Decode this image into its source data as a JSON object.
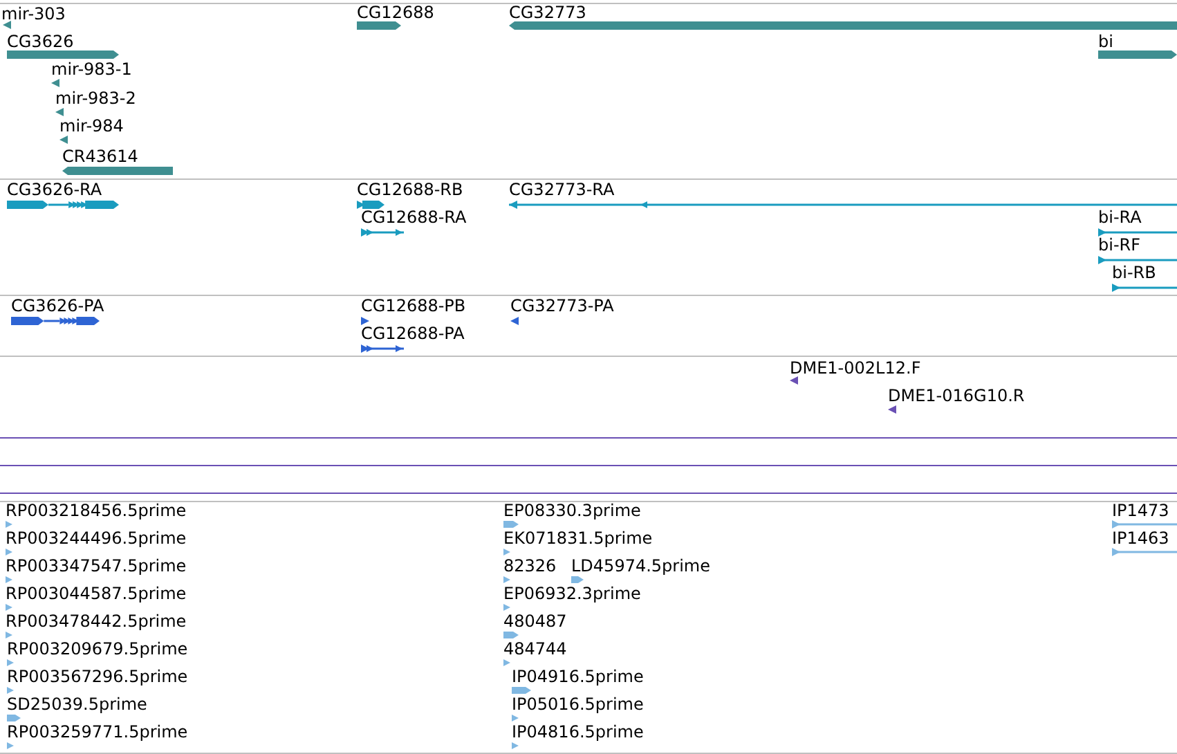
{
  "tracks": [
    {
      "kind": "gene",
      "color": "#3f8f91",
      "features": [
        {
          "label": "mir-303",
          "kind": "tick",
          "reverse": true
        },
        {
          "label": "CG3626",
          "kind": "block",
          "reverse": false
        },
        {
          "label": "mir-983-1",
          "kind": "tick",
          "reverse": true
        },
        {
          "label": "mir-983-2",
          "kind": "tick",
          "reverse": true
        },
        {
          "label": "mir-984",
          "kind": "tick",
          "reverse": true
        },
        {
          "label": "CR43614",
          "kind": "block",
          "reverse": true
        },
        {
          "label": "CG12688",
          "kind": "block",
          "reverse": false
        },
        {
          "label": "CG32773",
          "kind": "block",
          "reverse": true
        },
        {
          "label": "bi",
          "kind": "block",
          "reverse": false
        }
      ]
    },
    {
      "kind": "transcript",
      "color": "#1a9cbf",
      "features": [
        {
          "label": "CG3626-RA",
          "kind": "spliced",
          "reverse": false
        },
        {
          "label": "CG12688-RB",
          "kind": "spliced",
          "reverse": false
        },
        {
          "label": "CG12688-RA",
          "kind": "line",
          "reverse": false
        },
        {
          "label": "CG32773-RA",
          "kind": "line",
          "reverse": true
        },
        {
          "label": "bi-RA",
          "kind": "line",
          "reverse": false
        },
        {
          "label": "bi-RF",
          "kind": "line",
          "reverse": false
        },
        {
          "label": "bi-RB",
          "kind": "line",
          "reverse": false
        }
      ]
    },
    {
      "kind": "protein",
      "color": "#2e64d4",
      "features": [
        {
          "label": "CG3626-PA",
          "kind": "spliced",
          "reverse": false
        },
        {
          "label": "CG12688-PB",
          "kind": "tick",
          "reverse": false
        },
        {
          "label": "CG12688-PA",
          "kind": "line",
          "reverse": false
        },
        {
          "label": "CG32773-PA",
          "kind": "tick",
          "reverse": true
        }
      ]
    },
    {
      "kind": "clone",
      "color": "#6a50b4",
      "features": [
        {
          "label": "DME1-002L12.F",
          "kind": "tick",
          "reverse": true
        },
        {
          "label": "DME1-016G10.R",
          "kind": "tick",
          "reverse": true
        }
      ]
    },
    {
      "kind": "est",
      "color": "#80b8e2",
      "features": [
        {
          "label": "RP003218456.5prime",
          "kind": "tick",
          "reverse": false
        },
        {
          "label": "RP003244496.5prime",
          "kind": "tick",
          "reverse": false
        },
        {
          "label": "RP003347547.5prime",
          "kind": "tick",
          "reverse": false
        },
        {
          "label": "RP003044587.5prime",
          "kind": "tick",
          "reverse": false
        },
        {
          "label": "RP003478442.5prime",
          "kind": "tick",
          "reverse": false
        },
        {
          "label": "RP003209679.5prime",
          "kind": "tick",
          "reverse": false
        },
        {
          "label": "RP003567296.5prime",
          "kind": "tick",
          "reverse": false
        },
        {
          "label": "SD25039.5prime",
          "kind": "block",
          "reverse": false
        },
        {
          "label": "RP003259771.5prime",
          "kind": "tick",
          "reverse": false
        },
        {
          "label": "EP08330.3prime",
          "kind": "block",
          "reverse": false
        },
        {
          "label": "EK071831.5prime",
          "kind": "tick",
          "reverse": false
        },
        {
          "label": "82326",
          "kind": "tick",
          "reverse": false
        },
        {
          "label": "LD45974.5prime",
          "kind": "block",
          "reverse": false
        },
        {
          "label": "EP06932.3prime",
          "kind": "tick",
          "reverse": false
        },
        {
          "label": "480487",
          "kind": "block",
          "reverse": false
        },
        {
          "label": "484744",
          "kind": "tick",
          "reverse": false
        },
        {
          "label": "IP04916.5prime",
          "kind": "block",
          "reverse": false
        },
        {
          "label": "IP05016.5prime",
          "kind": "tick",
          "reverse": false
        },
        {
          "label": "IP04816.5prime",
          "kind": "tick",
          "reverse": false
        },
        {
          "label": "IP1473",
          "kind": "line",
          "reverse": false
        },
        {
          "label": "IP1463",
          "kind": "line",
          "reverse": false
        }
      ]
    }
  ]
}
